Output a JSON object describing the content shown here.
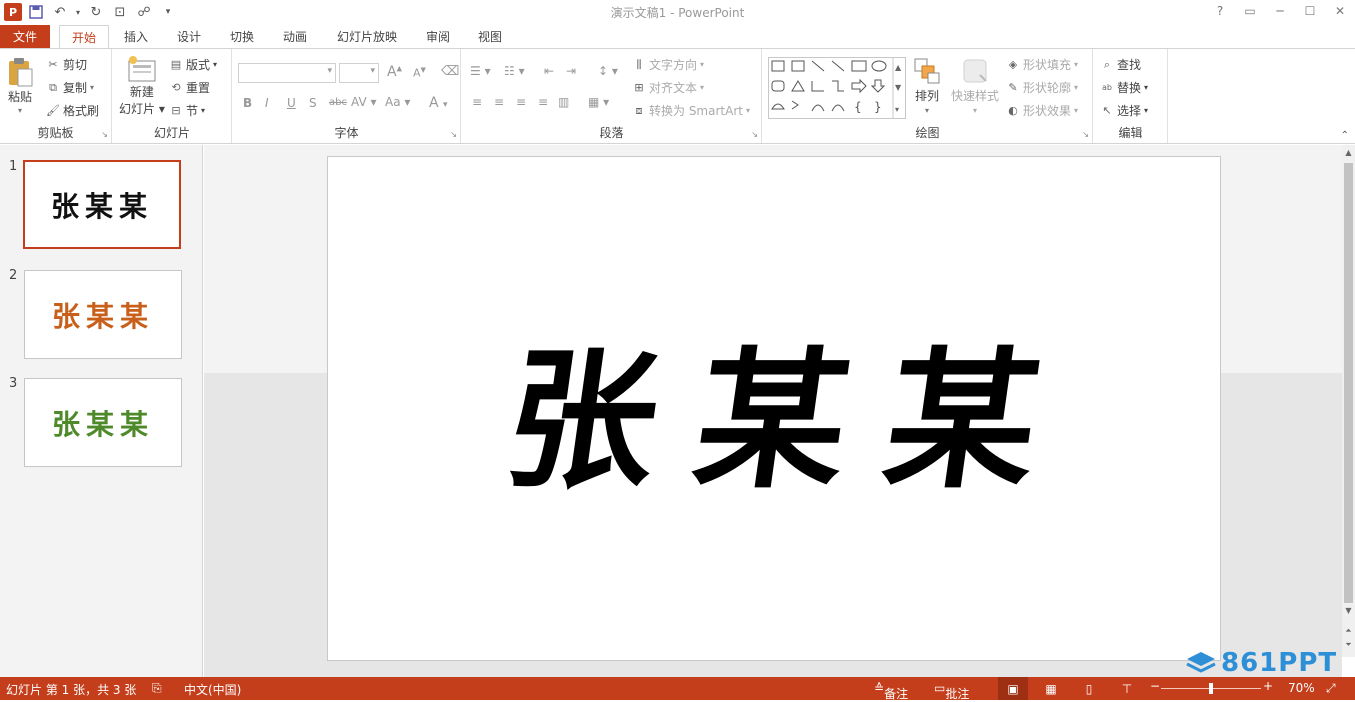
{
  "window": {
    "title": "演示文稿1 - PowerPoint"
  },
  "qat": {
    "logo": "P"
  },
  "tabs": [
    {
      "label": "文件"
    },
    {
      "label": "开始"
    },
    {
      "label": "插入"
    },
    {
      "label": "设计"
    },
    {
      "label": "切换"
    },
    {
      "label": "动画"
    },
    {
      "label": "幻灯片放映"
    },
    {
      "label": "审阅"
    },
    {
      "label": "视图"
    }
  ],
  "ribbon": {
    "clipboard": {
      "group": "剪贴板",
      "paste": "粘贴",
      "cut": "剪切",
      "copy": "复制",
      "format_painter": "格式刷"
    },
    "slides": {
      "group": "幻灯片",
      "new_slide_1": "新建",
      "new_slide_2": "幻灯片",
      "layout": "版式",
      "reset": "重置",
      "section": "节"
    },
    "font": {
      "group": "字体",
      "bold": "B",
      "italic": "I",
      "underline": "U",
      "shadow": "S",
      "strike": "abc",
      "spacing": "AV",
      "case": "Aa",
      "color": "A",
      "grow": "A",
      "shrink": "A"
    },
    "paragraph": {
      "group": "段落",
      "text_direction": "文字方向",
      "align_text": "对齐文本",
      "smartart": "转换为 SmartArt"
    },
    "drawing": {
      "group": "绘图",
      "arrange": "排列",
      "quick_styles": "快速样式",
      "fill": "形状填充",
      "outline": "形状轮廓",
      "effects": "形状效果"
    },
    "editing": {
      "group": "编辑",
      "find": "查找",
      "replace": "替换",
      "select": "选择"
    }
  },
  "thumbnails": [
    {
      "number": "1",
      "text": "张某某",
      "color": "#111111"
    },
    {
      "number": "2",
      "text": "张某某",
      "color": "#c8601c"
    },
    {
      "number": "3",
      "text": "张某某",
      "color": "#4e8a2a"
    }
  ],
  "slide": {
    "text": "张某某"
  },
  "status": {
    "slide_info": "幻灯片 第 1 张，共 3 张",
    "language": "中文(中国)",
    "notes": "备注",
    "comments": "批注",
    "zoom": "70%",
    "zoom_fraction": 0.5
  },
  "watermark": {
    "text": "861PPT"
  },
  "colors": {
    "accent": "#c43e1c",
    "watermark": "#2d8fd6"
  }
}
